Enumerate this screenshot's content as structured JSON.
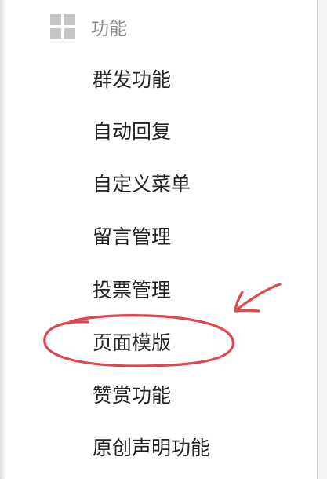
{
  "section": {
    "title": "功能",
    "icon": "grid-icon"
  },
  "menu": {
    "items": [
      {
        "label": "群发功能"
      },
      {
        "label": "自动回复"
      },
      {
        "label": "自定义菜单"
      },
      {
        "label": "留言管理"
      },
      {
        "label": "投票管理"
      },
      {
        "label": "页面模版"
      },
      {
        "label": "赞赏功能"
      },
      {
        "label": "原创声明功能"
      }
    ]
  },
  "annotation": {
    "color": "#e0474c",
    "highlighted_item": "页面模版",
    "shapes": [
      "ellipse-highlight",
      "arrow-pointer"
    ]
  }
}
